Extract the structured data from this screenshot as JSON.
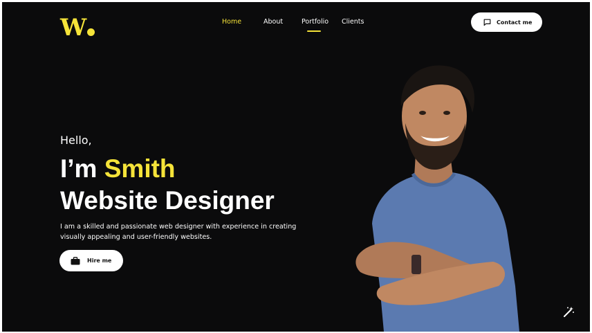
{
  "logo": {
    "letter": "W",
    "color": "#f5e339"
  },
  "nav": {
    "items": [
      {
        "label": "Home",
        "active": true
      },
      {
        "label": "About",
        "active": false
      },
      {
        "label": "Portfolio",
        "active": false,
        "underlined": true
      },
      {
        "label": "Clients",
        "active": false
      }
    ]
  },
  "contact_button": {
    "label": "Contact me",
    "icon": "chat-bubble-icon"
  },
  "hero": {
    "greeting": "Hello,",
    "intro_prefix": "I’m ",
    "name": "Smith",
    "role": "Website Designer",
    "description": "I am a skilled and passionate web designer with experience in creating visually appealing and user-friendly websites.",
    "hire_button": {
      "label": "Hire me",
      "icon": "briefcase-icon"
    }
  },
  "portrait": {
    "icon": "person-photo",
    "shirt_color": "#5b7ab0"
  },
  "magic_button": {
    "icon": "magic-wand-icon"
  },
  "colors": {
    "background": "#0b0b0c",
    "accent": "#f5e339",
    "text": "#ffffff"
  }
}
